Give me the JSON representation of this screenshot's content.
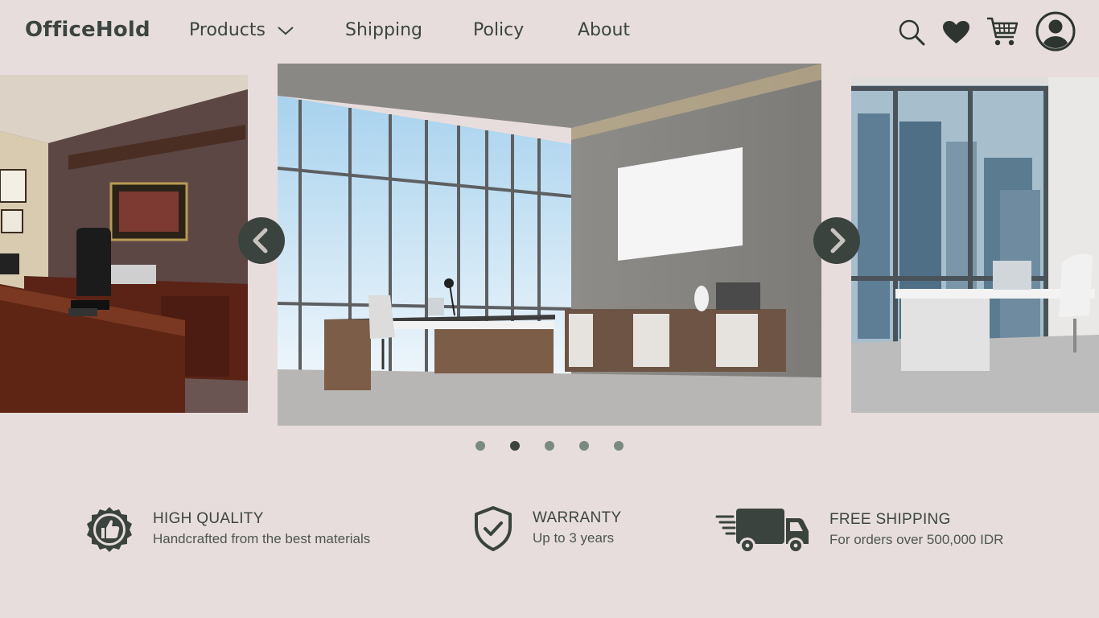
{
  "brand": {
    "name": "OfficeHold"
  },
  "nav": {
    "products": "Products",
    "shipping": "Shipping",
    "policy": "Policy",
    "about": "About"
  },
  "header_icons": [
    "search-icon",
    "heart-icon",
    "cart-icon",
    "user-icon"
  ],
  "carousel": {
    "slide_count": 5,
    "active_index": 1,
    "slides_visible": [
      "classic-office-photo",
      "modern-office-photo",
      "city-view-office-photo"
    ]
  },
  "features": [
    {
      "icon": "thumbs-up-badge-icon",
      "title": "HIGH QUALITY",
      "subtitle": "Handcrafted from the best materials"
    },
    {
      "icon": "shield-check-icon",
      "title": "WARRANTY",
      "subtitle": "Up to 3 years"
    },
    {
      "icon": "delivery-truck-icon",
      "title": "FREE SHIPPING",
      "subtitle": "For orders over 500,000 IDR"
    }
  ],
  "colors": {
    "background": "#e7dddc",
    "accent_dark": "#3a433d",
    "dot_inactive": "#7a8a7f"
  }
}
